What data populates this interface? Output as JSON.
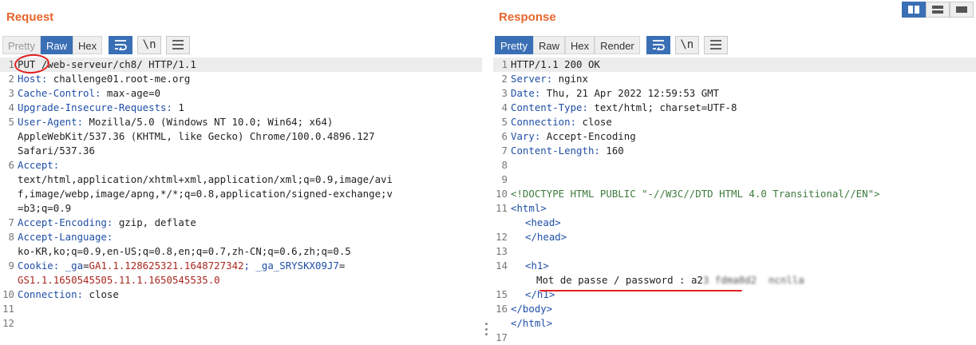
{
  "request": {
    "title": "Request",
    "tabs": [
      {
        "label": "Pretty",
        "state": "disabled"
      },
      {
        "label": "Raw",
        "state": "active"
      },
      {
        "label": "Hex",
        "state": "normal"
      }
    ],
    "tool_newline": "\\n",
    "lines": [
      {
        "n": "1",
        "method": "PUT",
        "rest": " /web-serveur/ch8/ HTTP/1.1"
      },
      {
        "n": "2",
        "name": "Host:",
        "value": " challenge01.root-me.org"
      },
      {
        "n": "3",
        "name": "Cache-Control:",
        "value": " max-age=0"
      },
      {
        "n": "4",
        "name": "Upgrade-Insecure-Requests:",
        "value": " 1"
      },
      {
        "n": "5",
        "name": "User-Agent:",
        "value": " Mozilla/5.0 (Windows NT 10.0; Win64; x64)",
        "cont": [
          "AppleWebKit/537.36 (KHTML, like Gecko) Chrome/100.0.4896.127",
          "Safari/537.36"
        ]
      },
      {
        "n": "6",
        "name": "Accept:",
        "value": "",
        "cont": [
          "text/html,application/xhtml+xml,application/xml;q=0.9,image/avi",
          "f,image/webp,image/apng,*/*;q=0.8,application/signed-exchange;v",
          "=b3;q=0.9"
        ]
      },
      {
        "n": "7",
        "name": "Accept-Encoding:",
        "value": " gzip, deflate"
      },
      {
        "n": "8",
        "name": "Accept-Language:",
        "value": "",
        "cont": [
          "ko-KR,ko;q=0.9,en-US;q=0.8,en;q=0.7,zh-CN;q=0.6,zh;q=0.5"
        ]
      },
      {
        "n": "9",
        "name": "Cookie:",
        "cookie": true,
        "c1n": " _ga",
        "c1v": "GA1.1.128625321.1648727342",
        "c2n": "; _ga_SRYSKX09J7",
        "c2v": "GS1.1.1650545505.11.1.1650545535.0"
      },
      {
        "n": "10",
        "name": "Connection:",
        "value": " close"
      },
      {
        "n": "11"
      },
      {
        "n": "12"
      }
    ]
  },
  "response": {
    "title": "Response",
    "tabs": [
      {
        "label": "Pretty",
        "state": "active"
      },
      {
        "label": "Raw",
        "state": "normal"
      },
      {
        "label": "Hex",
        "state": "normal"
      },
      {
        "label": "Render",
        "state": "normal"
      }
    ],
    "tool_newline": "\\n",
    "status_line": "HTTP/1.1 200 OK",
    "headers": [
      {
        "n": "2",
        "name": "Server:",
        "value": " nginx"
      },
      {
        "n": "3",
        "name": "Date:",
        "value": " Thu, 21 Apr 2022 12:59:53 GMT"
      },
      {
        "n": "4",
        "name": "Content-Type:",
        "value": " text/html; charset=UTF-8"
      },
      {
        "n": "5",
        "name": "Connection:",
        "value": " close"
      },
      {
        "n": "6",
        "name": "Vary:",
        "value": " Accept-Encoding"
      },
      {
        "n": "7",
        "name": "Content-Length:",
        "value": " 160"
      }
    ],
    "doctype": "<!DOCTYPE HTML PUBLIC \"-//W3C//DTD HTML 4.0 Transitional//EN\">",
    "html_open": "<html>",
    "head_open": "<head>",
    "head_close": "</head>",
    "h1_open": "<h1>",
    "password_label": "Mot de passe / password : ",
    "password_visible": "a2",
    "password_blurred": "3 fdma8d2  ncnlla  ",
    "h1_close": "</h1>",
    "body_close": "</body>",
    "html_close": "</html>"
  }
}
